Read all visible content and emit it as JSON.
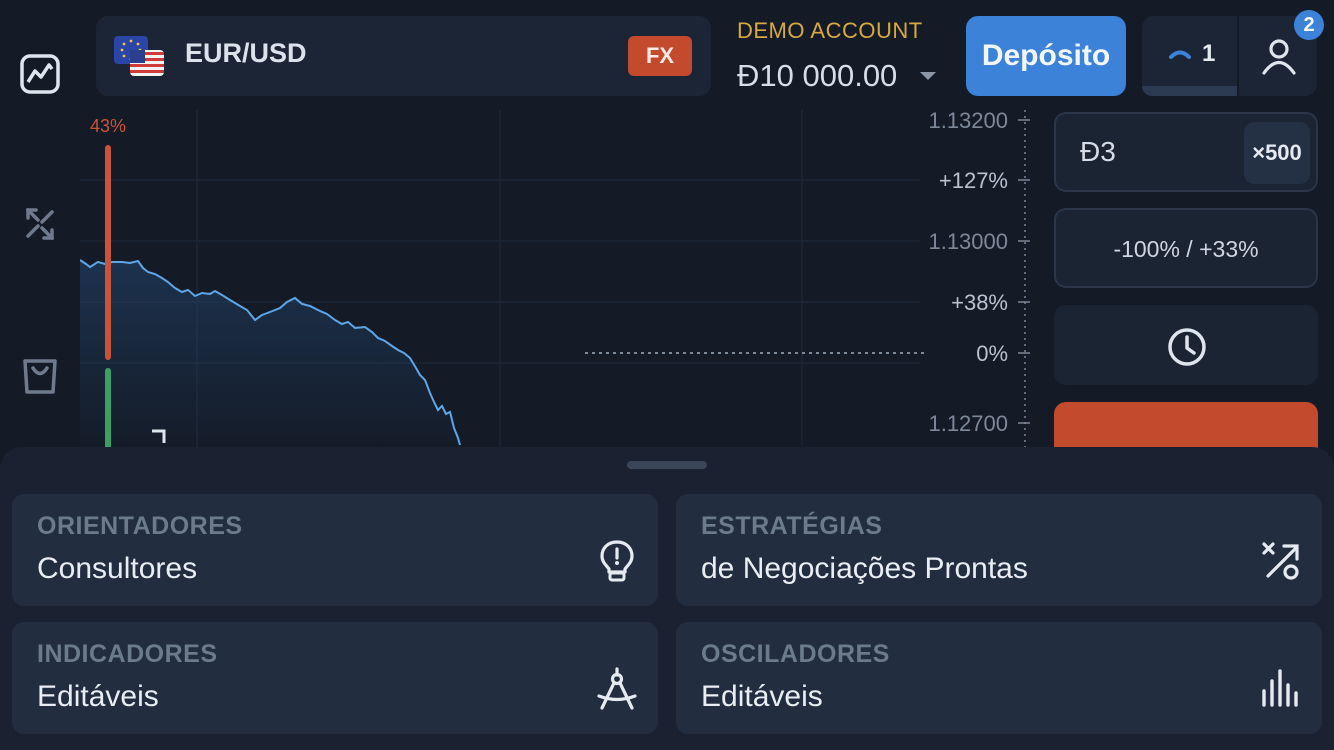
{
  "top": {
    "asset": "EUR/USD",
    "asset_type": "FX",
    "account_label": "DEMO ACCOUNT",
    "balance": "Đ10 000.00",
    "deposit_label": "Depósito",
    "open_trades": "1",
    "notifications": "2"
  },
  "chart": {
    "sentiment_pct": "43%",
    "axis": [
      "1.13200",
      "+127%",
      "1.13000",
      "+38%",
      "0%",
      "1.12700"
    ]
  },
  "trade": {
    "amount": "Đ3",
    "multiplier": "×500",
    "range": "-100% / +33%"
  },
  "sheet": {
    "cards": [
      {
        "title": "ORIENTADORES",
        "subtitle": "Consultores",
        "icon": "lightbulb-icon"
      },
      {
        "title": "ESTRATÉGIAS",
        "subtitle": "de Negociações Prontas",
        "icon": "strategy-icon"
      },
      {
        "title": "INDICADORES",
        "subtitle": "Editáveis",
        "icon": "compass-icon"
      },
      {
        "title": "OSCILADORES",
        "subtitle": "Editáveis",
        "icon": "oscillator-bars-icon"
      }
    ]
  },
  "colors": {
    "accent_blue": "#3b82d8",
    "sell_red": "#c34a2d",
    "buy_green": "#3aa064",
    "demo_gold": "#d7a93f"
  }
}
